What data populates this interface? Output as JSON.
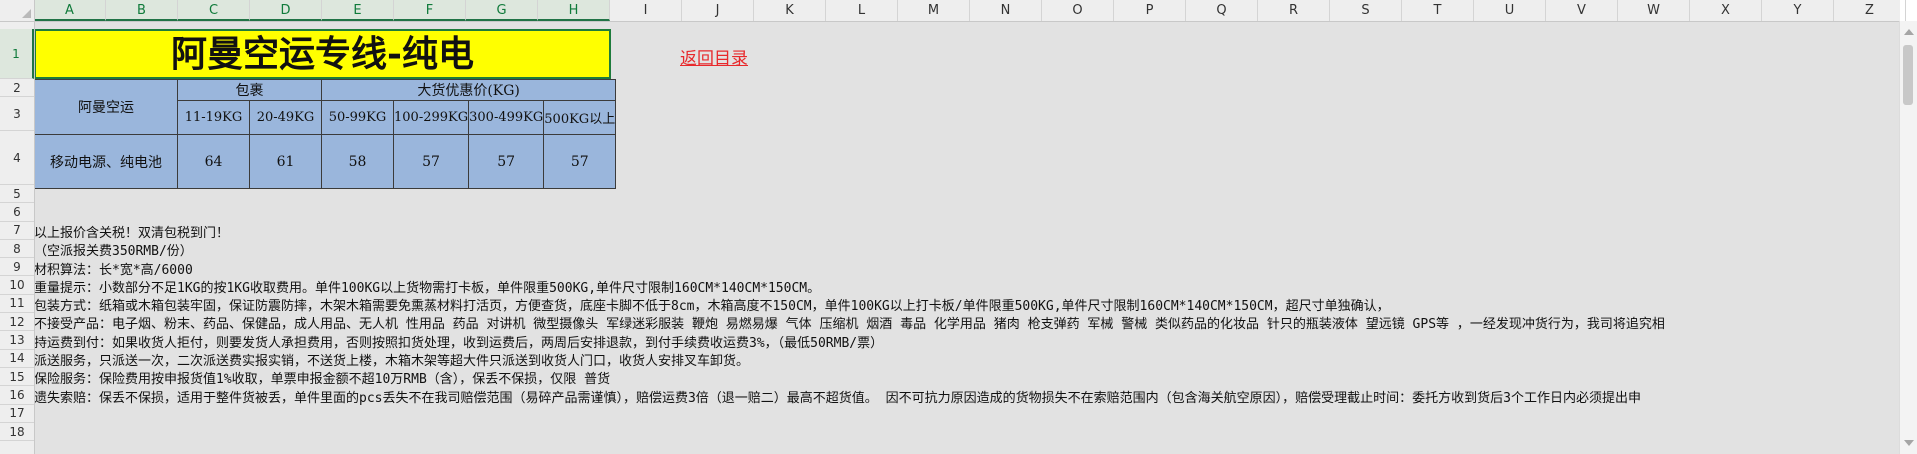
{
  "columns": [
    "A",
    "B",
    "C",
    "D",
    "E",
    "F",
    "G",
    "H",
    "I",
    "J",
    "K",
    "L",
    "M",
    "N",
    "O",
    "P",
    "Q",
    "R",
    "S",
    "T",
    "U",
    "V",
    "W",
    "X",
    "Y",
    "Z"
  ],
  "rows": [
    "1",
    "2",
    "3",
    "4",
    "5",
    "6",
    "7",
    "8",
    "9",
    "10",
    "11",
    "12",
    "13",
    "14",
    "15",
    "16",
    "17",
    "18"
  ],
  "title": "阿曼空运专线-纯电",
  "return_link": "返回目录",
  "table": {
    "row_label": "阿曼空运",
    "group_package": "包裹",
    "group_bulk": "大货优惠价(KG)",
    "weight_ranges": [
      "11-19KG",
      "20-49KG",
      "50-99KG",
      "100-299KG",
      "300-499KG",
      "500KG以上"
    ],
    "product": "移动电源、纯电池",
    "prices": [
      "64",
      "61",
      "58",
      "57",
      "57",
      "57"
    ]
  },
  "notes": [
    "以上报价含关税！双清包税到门！",
    "（空派报关费350RMB/份）",
    "材积算法：长*宽*高/6000",
    "重量提示：小数部分不足1KG的按1KG收取费用。单件100KG以上货物需打卡板，单件限重500KG,单件尺寸限制160CM*140CM*150CM。",
    "包装方式：纸箱或木箱包装牢固，保证防震防摔，木架木箱需要免熏蒸材料打活页，方便查货，底座卡脚不低于8cm，木箱高度不150CM，单件100KG以上打卡板/单件限重500KG,单件尺寸限制160CM*140CM*150CM，超尺寸单独确认，",
    "不接受产品：电子烟、粉末、药品、保健品，成人用品、无人机 性用品 药品 对讲机  微型摄像头 军绿迷彩服装 鞭炮 易燃易爆 气体 压缩机 烟酒 毒品 化学用品 猪肉 枪支弹药 军械 警械 类似药品的化妆品 针只的瓶装液体 望远镜 GPS等 ，一经发现冲货行为，我司将追究相",
    "持运费到付：如果收货人拒付，则要发货人承担费用，否则按照扣货处理，收到运费后，两周后安排退款，到付手续费收运费3%，（最低50RMB/票）",
    "派送服务，只派送一次，二次派送费实报实销，不送货上楼，木箱木架等超大件只派送到收货人门口，收货人安排叉车卸货。",
    "保险服务：保险费用按申报货值1%收取，单票申报金额不超10万RMB（含），保丢不保损，仅限 普货",
    "遗失索赔：保丢不保损，适用于整件货被丢，单件里面的pcs丢失不在我司赔偿范围（易碎产品需谨慎），赔偿运费3倍（退一赔二）最高不超货值。   因不可抗力原因造成的货物损失不在索赔范围内（包含海关航空原因），赔偿受理截止时间：委托方收到货后3个工作日内必须提出申"
  ],
  "colors": {
    "title_fill": "#ffff00",
    "table_fill": "#9ab6dc",
    "selection": "#217346",
    "link": "#e8282b"
  }
}
